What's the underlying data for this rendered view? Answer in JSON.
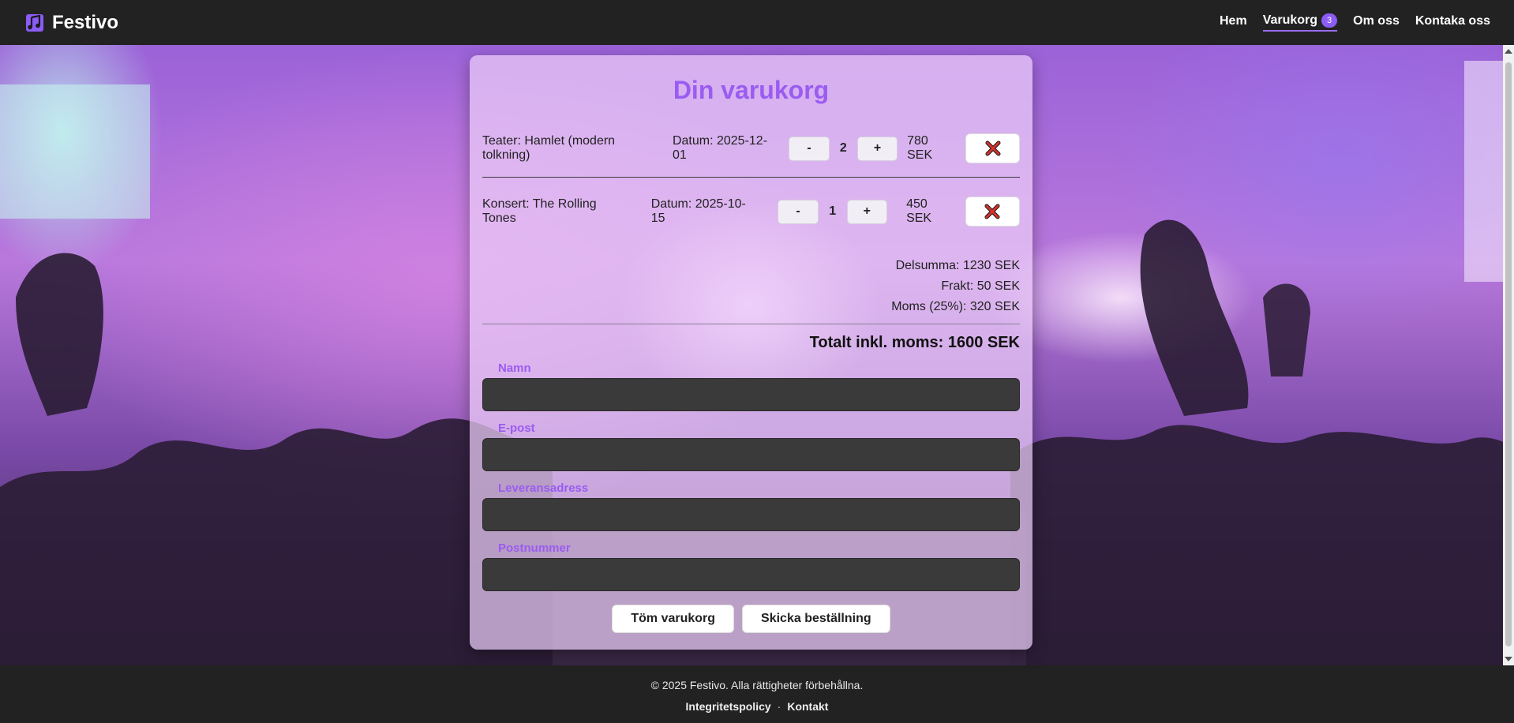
{
  "brand": {
    "name": "Festivo",
    "icon": "music-notes-icon"
  },
  "nav": {
    "items": [
      {
        "label": "Hem"
      },
      {
        "label": "Varukorg",
        "badge": "3",
        "active": true
      },
      {
        "label": "Om oss"
      },
      {
        "label": "Kontaka oss"
      }
    ]
  },
  "cart": {
    "title": "Din varukorg",
    "items": [
      {
        "name": "Teater: Hamlet (modern tolkning)",
        "date": "Datum: 2025-12-01",
        "qty": "2",
        "price": "780 SEK",
        "minus": "-",
        "plus": "+"
      },
      {
        "name": "Konsert: The Rolling Tones",
        "date": "Datum: 2025-10-15",
        "qty": "1",
        "price": "450 SEK",
        "minus": "-",
        "plus": "+"
      }
    ],
    "subtotal": "Delsumma: 1230 SEK",
    "shipping": "Frakt: 50 SEK",
    "vat": "Moms (25%): 320 SEK",
    "total": "Totalt inkl. moms: 1600 SEK"
  },
  "form": {
    "name_label": "Namn",
    "email_label": "E-post",
    "address_label": "Leveransadress",
    "zip_label": "Postnummer",
    "name_value": "",
    "email_value": "",
    "address_value": "",
    "zip_value": ""
  },
  "actions": {
    "clear_label": "Töm varukorg",
    "submit_label": "Skicka beställning"
  },
  "footer": {
    "copyright": "© 2025 Festivo. Alla rättigheter förbehållna.",
    "privacy": "Integritetspolicy",
    "separator": "·",
    "contact": "Kontakt"
  },
  "colors": {
    "accent": "#9a5cf0",
    "header_bg": "#222222",
    "field_bg": "#3a3a3a",
    "remove_icon": "#c0392b"
  }
}
